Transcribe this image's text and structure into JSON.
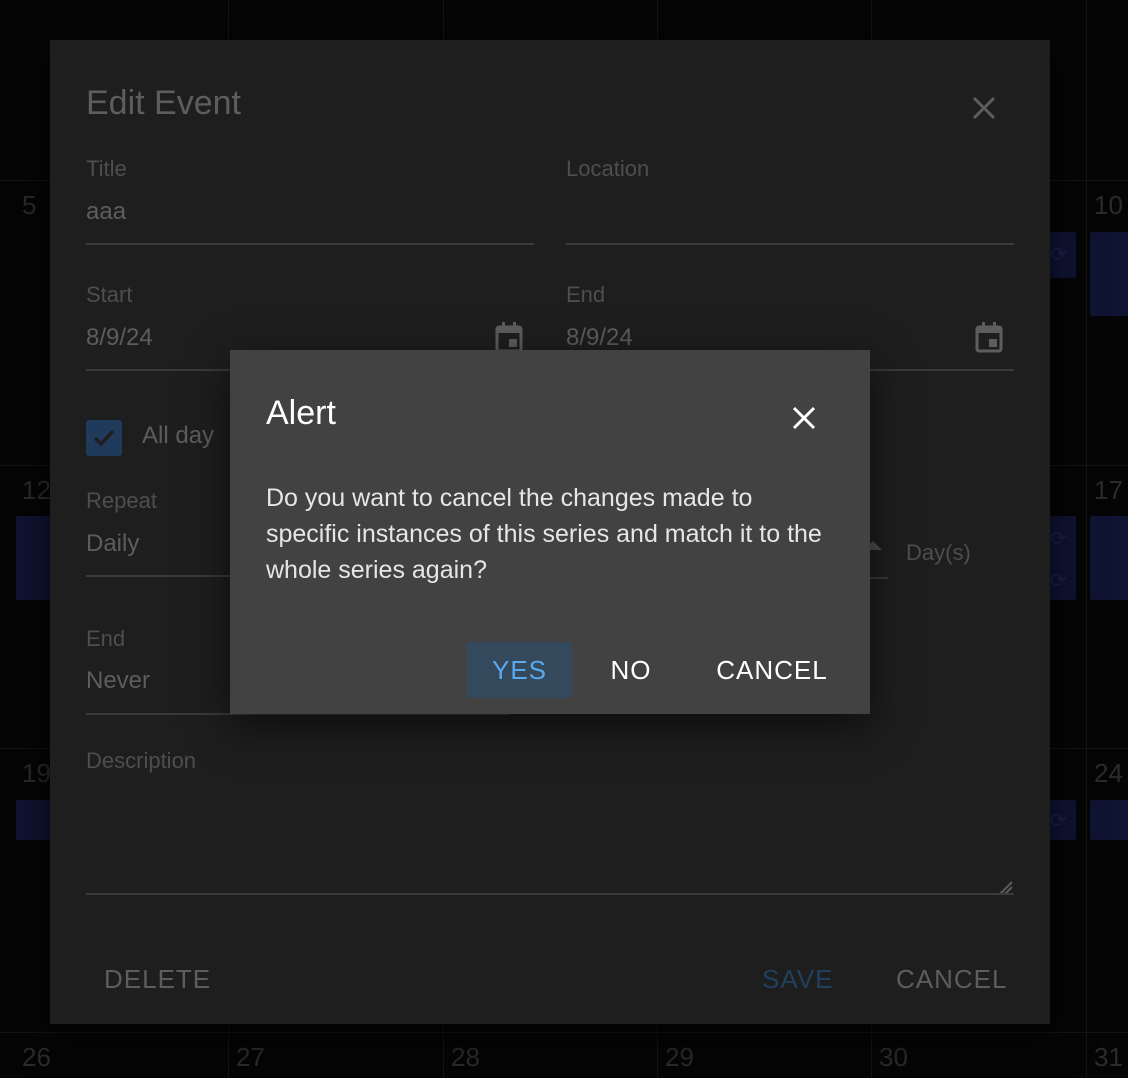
{
  "calendar": {
    "day_numbers": [
      "5",
      "10",
      "12",
      "17",
      "19",
      "24",
      "26",
      "27",
      "28",
      "29",
      "30",
      "31"
    ]
  },
  "edit_event": {
    "title": "Edit Event",
    "fields": {
      "title_label": "Title",
      "title_value": "aaa",
      "location_label": "Location",
      "location_value": "",
      "start_label": "Start",
      "start_value": "8/9/24",
      "end_label": "End",
      "end_value": "8/9/24",
      "all_day_label": "All day",
      "all_day_checked": true,
      "repeat_label": "Repeat",
      "repeat_value": "Daily",
      "interval_unit": "Day(s)",
      "repeat_end_label": "End",
      "repeat_end_value": "Never",
      "description_label": "Description",
      "description_value": ""
    },
    "footer": {
      "delete_label": "DELETE",
      "save_label": "SAVE",
      "cancel_label": "CANCEL"
    }
  },
  "alert": {
    "title": "Alert",
    "message": "Do you want to cancel the changes made to specific instances of this series and match it to the whole series again?",
    "buttons": {
      "yes": "YES",
      "no": "NO",
      "cancel": "CANCEL"
    }
  },
  "colors": {
    "accent": "#5aa9ee",
    "alert_bg": "#424242",
    "dialog_bg": "#1e1e1e"
  }
}
